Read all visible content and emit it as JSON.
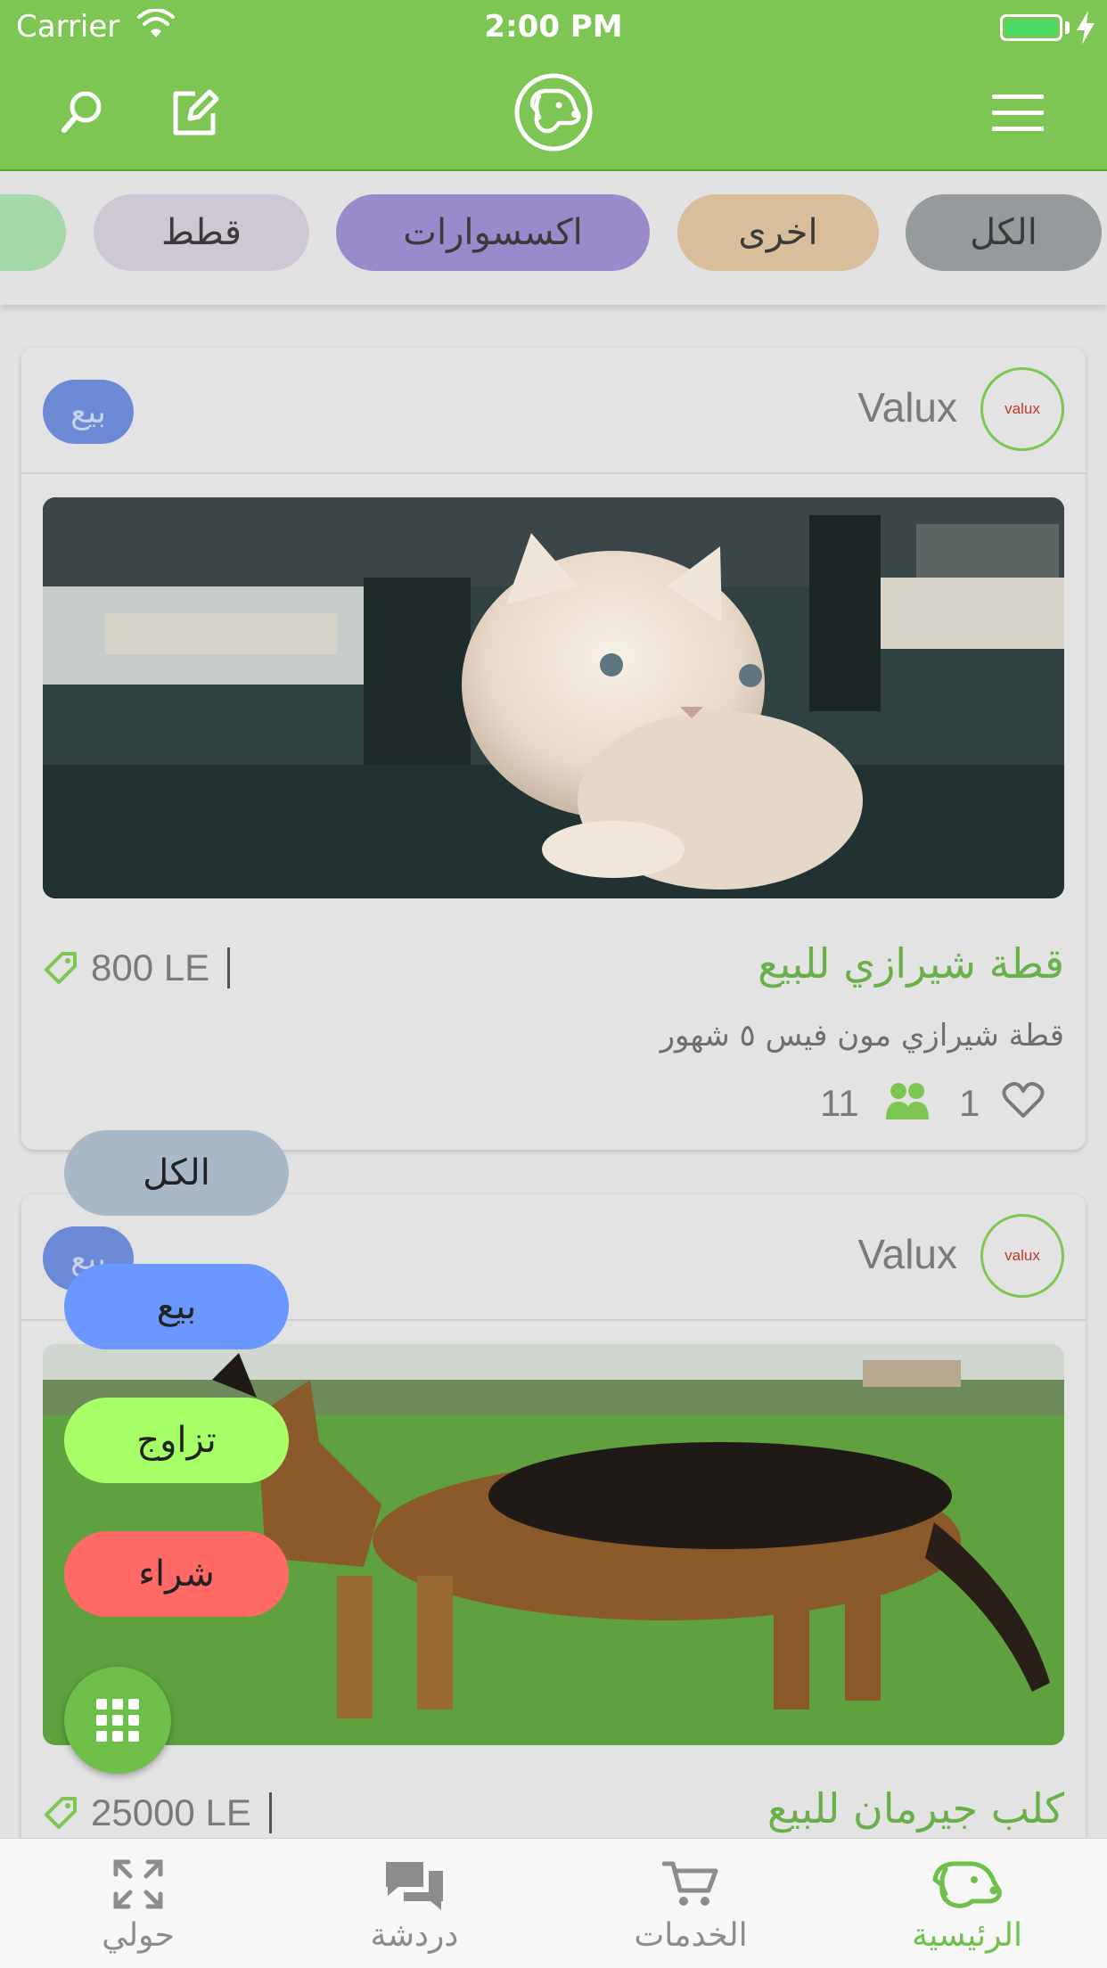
{
  "status_bar": {
    "carrier": "Carrier",
    "time": "2:00 PM",
    "battery_color": "#4cd964"
  },
  "nav": {
    "brand_color": "#7dc653",
    "icons": [
      "search-icon",
      "compose-icon",
      "dog-logo-icon",
      "menu-icon"
    ]
  },
  "chips": [
    {
      "label": "الكل",
      "color": "#959b9d"
    },
    {
      "label": "اخرى",
      "color": "#d9be9b"
    },
    {
      "label": "اكسسوارات",
      "color": "#9b8acb"
    },
    {
      "label": "قطط",
      "color": "#cfc7d3"
    },
    {
      "label": "",
      "color": "#a6d9a9"
    }
  ],
  "posts": [
    {
      "avatar_text": "valux",
      "seller": "Valux",
      "type": "بيع",
      "title": "قطة شيرازي للبيع",
      "description": "قطة شيرازي مون فيس ٥ شهور",
      "price": "800 LE",
      "likes": "1",
      "views": "11",
      "photo": "kitten-photo"
    },
    {
      "avatar_text": "valux",
      "seller": "Valux",
      "type": "بيع",
      "title": "كلب جيرمان للبيع",
      "description": "",
      "price": "25000 LE",
      "photo": "german-shepherd-photo"
    }
  ],
  "fab_menu": [
    {
      "label": "الكل",
      "color": "#a8b8c6"
    },
    {
      "label": "بيع",
      "color": "#6b98ff"
    },
    {
      "label": "تزاوج",
      "color": "#a6ff66"
    },
    {
      "label": "شراء",
      "color": "#ff6a66"
    }
  ],
  "tabs": [
    {
      "label": "الرئيسية",
      "icon": "dog-home-icon",
      "active": true
    },
    {
      "label": "الخدمات",
      "icon": "cart-icon",
      "active": false
    },
    {
      "label": "دردشة",
      "icon": "chat-icon",
      "active": false
    },
    {
      "label": "حولي",
      "icon": "expand-icon",
      "active": false
    }
  ],
  "colors": {
    "active_tab": "#6fbf4b",
    "inactive_tab": "#8c8c8c",
    "title_green": "#69b04a"
  }
}
